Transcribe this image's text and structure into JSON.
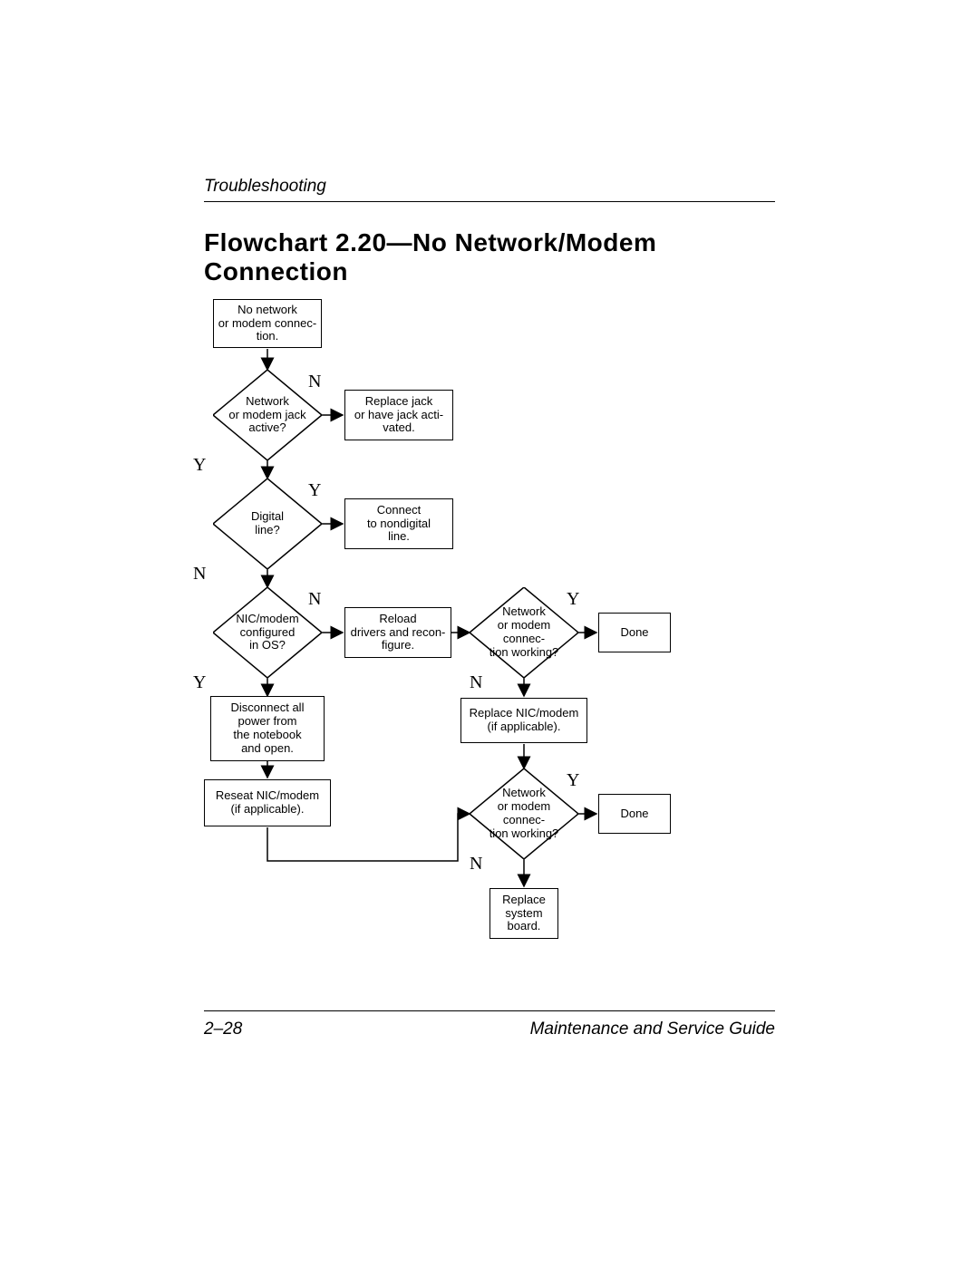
{
  "header": {
    "section": "Troubleshooting"
  },
  "title": "Flowchart 2.20—No Network/Modem\nConnection",
  "nodes": {
    "start": "No network\nor modem connec-\ntion.",
    "d_jack": "Network\nor modem jack\nactive?",
    "box_replace_jack": "Replace jack\nor have jack acti-\nvated.",
    "d_digital": "Digital\nline?",
    "box_nondigital": "Connect\nto nondigital\nline.",
    "d_configured": "NIC/modem\nconfigured\nin OS?",
    "box_reload": "Reload\ndrivers and recon-\nfigure.",
    "d_working1": "Network\nor modem connec-\ntion working?",
    "box_done1": "Done",
    "box_disconnect": "Disconnect all\npower from\nthe notebook\nand open.",
    "box_reseat": "Reseat NIC/modem\n(if applicable).",
    "box_replace_nic": "Replace NIC/modem\n(if applicable).",
    "d_working2": "Network\nor modem connec-\ntion working?",
    "box_done2": "Done",
    "box_replace_sys": "Replace\nsystem\nboard."
  },
  "labels": {
    "Y": "Y",
    "N": "N"
  },
  "footer": {
    "left": "2–28",
    "right": "Maintenance and Service Guide"
  }
}
